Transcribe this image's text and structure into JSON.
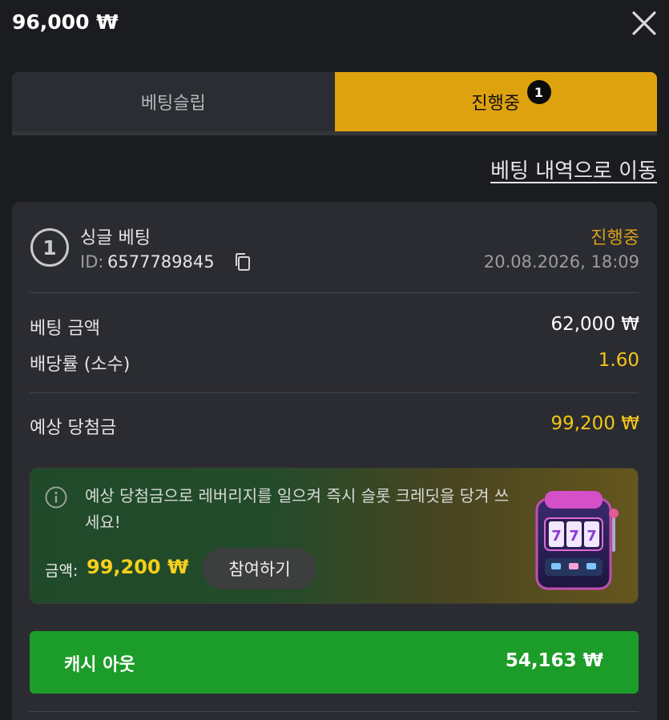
{
  "header": {
    "balance": "96,000 ₩"
  },
  "tabs": [
    {
      "label": "베팅슬립",
      "active": false
    },
    {
      "label": "진행중",
      "active": true,
      "badge": "1"
    }
  ],
  "history_link": "베팅 내역으로 이동",
  "bet": {
    "number": "1",
    "type": "싱글 베팅",
    "id_label": "ID:",
    "id_value": "6577789845",
    "status": "진행중",
    "datetime": "20.08.2026, 18:09",
    "rows": [
      {
        "label": "베팅 금액",
        "value": "62,000 ₩"
      },
      {
        "label": "배당률 (소수)",
        "value": "1.60"
      }
    ],
    "potential_win_label": "예상 당첨금",
    "potential_win_value": "99,200 ₩"
  },
  "promo": {
    "text": "예상 당첨금으로 레버리지를 일으켜 즉시 슬롯 크레딧을 당겨 쓰세요!",
    "amount_label": "금액:",
    "amount_value": "99,200 ₩",
    "join_label": "참여하기"
  },
  "cashout": {
    "label": "캐시 아웃",
    "value": "54,163 ₩"
  },
  "colors": {
    "accent_yellow": "#dfa20f",
    "status_orange": "#d9a017",
    "value_yellow": "#f3c51b",
    "cashout_green": "#1c9c28",
    "background": "#1b1c20",
    "card": "#2b2c31"
  }
}
